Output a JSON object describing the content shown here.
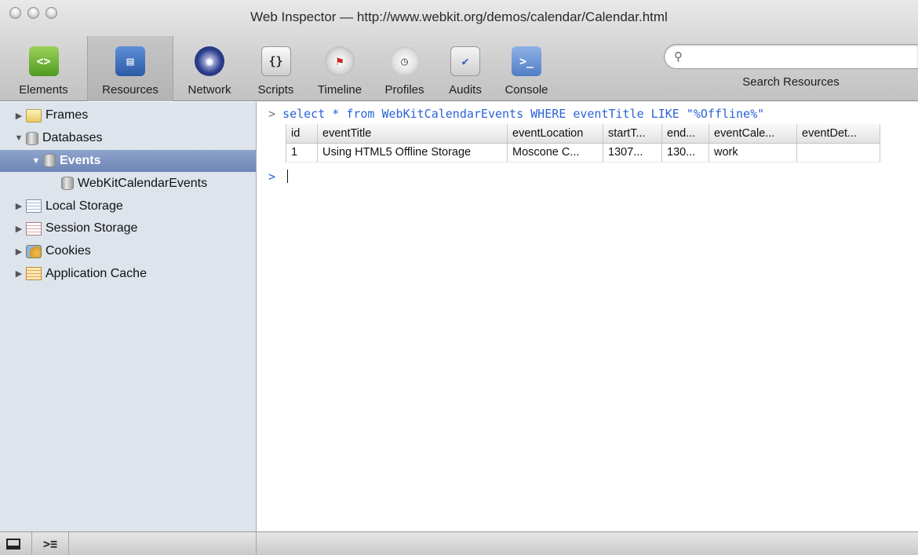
{
  "window": {
    "title": "Web Inspector — http://www.webkit.org/demos/calendar/Calendar.html"
  },
  "toolbar": {
    "items": [
      {
        "label": "Elements",
        "icon": "elements-icon",
        "selected": false
      },
      {
        "label": "Resources",
        "icon": "resources-icon",
        "selected": true
      },
      {
        "label": "Network",
        "icon": "network-icon",
        "selected": false
      },
      {
        "label": "Scripts",
        "icon": "scripts-icon",
        "selected": false
      },
      {
        "label": "Timeline",
        "icon": "timeline-icon",
        "selected": false
      },
      {
        "label": "Profiles",
        "icon": "profiles-icon",
        "selected": false
      },
      {
        "label": "Audits",
        "icon": "audits-icon",
        "selected": false
      },
      {
        "label": "Console",
        "icon": "console-icon",
        "selected": false
      }
    ],
    "search_label": "Search Resources",
    "search_value": "",
    "search_placeholder": ""
  },
  "sidebar": {
    "items": [
      {
        "label": "Frames",
        "depth": 0,
        "expanded": false,
        "icon": "folder-icon",
        "selected": false
      },
      {
        "label": "Databases",
        "depth": 0,
        "expanded": true,
        "icon": "database-icon",
        "selected": false
      },
      {
        "label": "Events",
        "depth": 1,
        "expanded": true,
        "icon": "database-icon",
        "selected": true
      },
      {
        "label": "WebKitCalendarEvents",
        "depth": 2,
        "expanded": null,
        "icon": "database-table-icon",
        "selected": false
      },
      {
        "label": "Local Storage",
        "depth": 0,
        "expanded": false,
        "icon": "local-storage-icon",
        "selected": false
      },
      {
        "label": "Session Storage",
        "depth": 0,
        "expanded": false,
        "icon": "session-storage-icon",
        "selected": false
      },
      {
        "label": "Cookies",
        "depth": 0,
        "expanded": false,
        "icon": "cookie-icon",
        "selected": false
      },
      {
        "label": "Application Cache",
        "depth": 0,
        "expanded": false,
        "icon": "app-cache-icon",
        "selected": false
      }
    ]
  },
  "console": {
    "prompt_glyph": ">",
    "query": "select * from WebKitCalendarEvents WHERE eventTitle LIKE \"%Offline%\"",
    "result": {
      "columns": [
        "id",
        "eventTitle",
        "eventLocation",
        "startT...",
        "end...",
        "eventCale...",
        "eventDet..."
      ],
      "rows": [
        [
          "1",
          "Using HTML5 Offline Storage",
          "Moscone C...",
          "1307...",
          "130...",
          "work",
          ""
        ]
      ]
    },
    "input_value": ""
  },
  "colors": {
    "query_text": "#2a63d8",
    "sidebar_bg": "#dde4ec",
    "selection": "#7a90c0"
  }
}
